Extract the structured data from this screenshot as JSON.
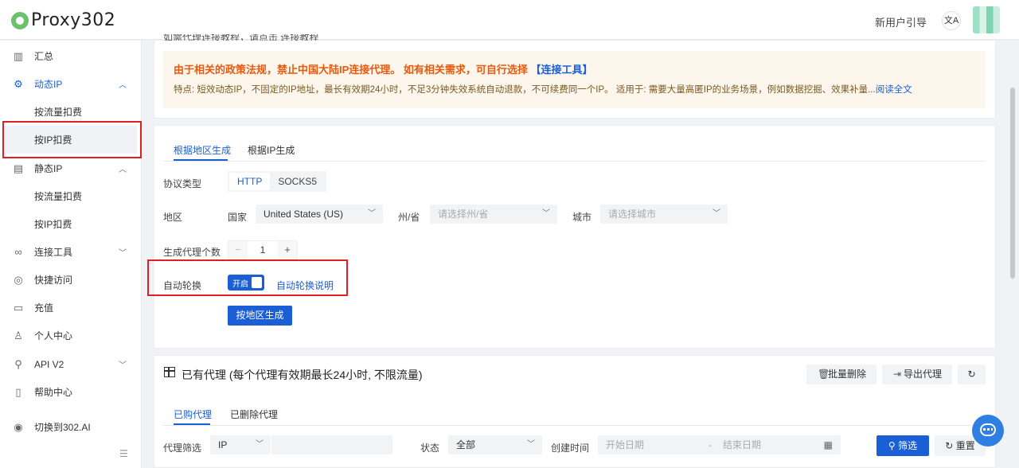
{
  "header": {
    "logo_text": "Proxy302",
    "guide": "新用户引导",
    "translate_icon": "文A"
  },
  "sidebar": {
    "items": [
      {
        "label": "汇总",
        "icon": "chart-icon"
      },
      {
        "label": "动态IP",
        "icon": "gear-icon",
        "expanded": true
      },
      {
        "label": "按流量扣费"
      },
      {
        "label": "按IP扣费",
        "selected": true
      },
      {
        "label": "静态IP",
        "icon": "server-icon",
        "expanded": true
      },
      {
        "label": "按流量扣费"
      },
      {
        "label": "按IP扣费"
      },
      {
        "label": "连接工具",
        "icon": "link-icon"
      },
      {
        "label": "快捷访问",
        "icon": "chrome-icon"
      },
      {
        "label": "充值",
        "icon": "card-icon"
      },
      {
        "label": "个人中心",
        "icon": "user-icon"
      },
      {
        "label": "API V2",
        "icon": "api-icon"
      },
      {
        "label": "帮助中心",
        "icon": "book-icon"
      },
      {
        "label": "切换到302.AI",
        "icon": "switch-icon"
      }
    ]
  },
  "notice": {
    "cut_text": "如需代理连接教程，请点击 连接教程",
    "title": "由于相关的政策法规，禁止中国大陆IP连接代理。 如有相关需求，可自行选择",
    "title_link": "【连接工具】",
    "desc": "特点: 短效动态IP，不固定的IP地址，最长有效期24小时，不足3分钟失效系统自动退款，不可续费同一个IP。 适用于: 需要大量高匿IP的业务场景，例如数据挖掘、效果补量...",
    "desc_link": "阅读全文"
  },
  "generator": {
    "tabs": [
      "根据地区生成",
      "根据IP生成"
    ],
    "protocol_label": "协议类型",
    "protocols": [
      "HTTP",
      "SOCKS5"
    ],
    "region_label": "地区",
    "country_label": "国家",
    "country_value": "United States (US)",
    "state_label": "州/省",
    "state_placeholder": "请选择州/省",
    "city_label": "城市",
    "city_placeholder": "请选择城市",
    "count_label": "生成代理个数",
    "count_value": "1",
    "rotate_label": "自动轮换",
    "rotate_state": "开启",
    "rotate_help": "自动轮换说明",
    "generate_button": "按地区生成"
  },
  "proxies": {
    "title": "已有代理 (每个代理有效期最长24小时, 不限流量)",
    "bulk_delete": "批量删除",
    "export": "导出代理",
    "tabs": [
      "已购代理",
      "已删除代理"
    ],
    "filter_label": "代理筛选",
    "filter_type": "IP",
    "status_label": "状态",
    "status_value": "全部",
    "created_label": "创建时间",
    "start_placeholder": "开始日期",
    "range_sep": "-",
    "end_placeholder": "结束日期",
    "search_button": "筛选",
    "reset_button": "重置"
  },
  "colors": {
    "accent": "#1a5fd6",
    "warning": "#e8590c",
    "highlight": "#e02020"
  }
}
